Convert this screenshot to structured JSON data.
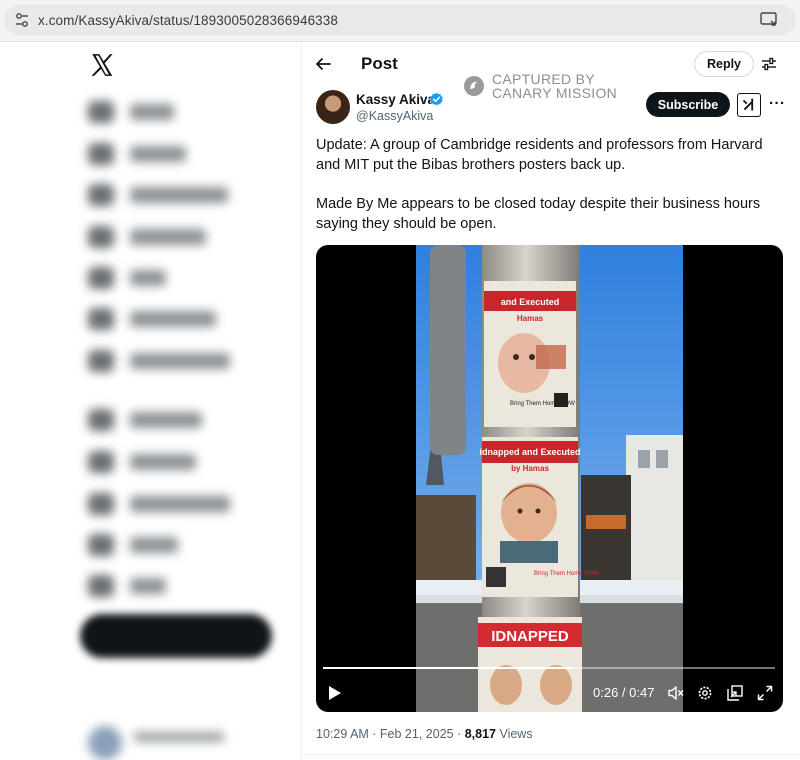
{
  "browser": {
    "url": "x.com/KassyAkiva/status/1893005028366946338"
  },
  "header": {
    "title": "Post",
    "reply_label": "Reply"
  },
  "watermark": {
    "line1": "CAPTURED BY",
    "line2": "CANARY MISSION"
  },
  "author": {
    "name": "Kassy Akiva",
    "handle": "@KassyAkiva",
    "subscribe_label": "Subscribe",
    "verified_color": "#1d9bf0"
  },
  "tweet": {
    "paragraph1": "Update: A group of Cambridge residents and professors from Harvard and MIT put the Bibas brothers posters back up.",
    "paragraph2": "Made By Me appears to be closed today despite their business hours saying they should be open."
  },
  "video": {
    "time": "0:26 / 0:47",
    "progress": 0.553,
    "poster_text": {
      "top_title": "and Executed",
      "top_sub": "Hamas",
      "mid_title": "idnapped and Executed",
      "mid_sub": "by Hamas",
      "bring_home": "Bring Them Home NOW",
      "bottom": "IDNAPPED"
    }
  },
  "meta": {
    "timestamp": "10:29 AM · Feb 21, 2025 · ",
    "views_count": "8,817",
    "views_label": " Views"
  },
  "colors": {
    "brand_dark": "#0f1419",
    "muted": "#536471",
    "accent_blue": "#1d9bf0"
  }
}
